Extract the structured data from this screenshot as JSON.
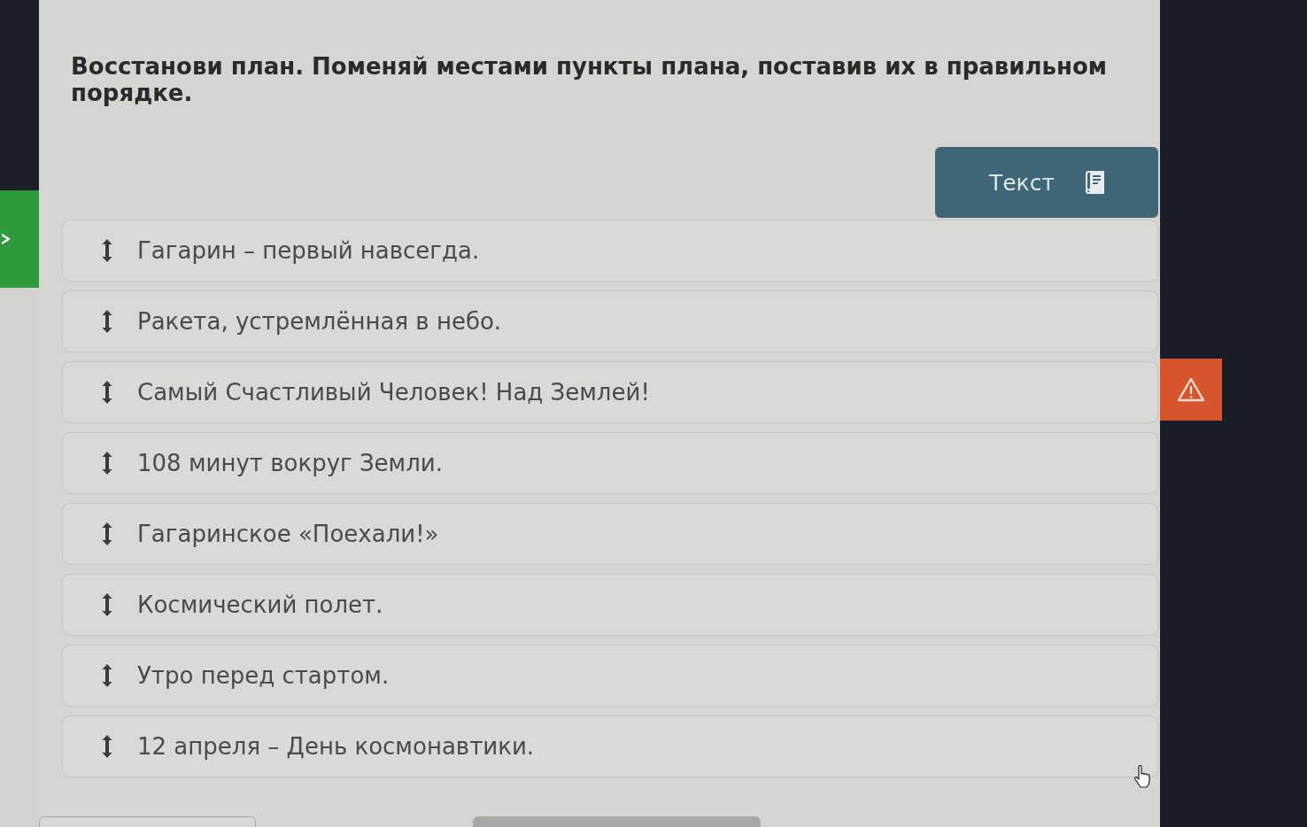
{
  "instruction": "Восстанови план. Поменяй местами пункты плана, поставив их в правильном порядке.",
  "text_button": {
    "label": "Текст"
  },
  "plan_items": [
    {
      "text": "Гагарин – первый навсегда."
    },
    {
      "text": "Ракета, устремлённая в небо."
    },
    {
      "text": "Самый Счастливый Человек! Над Землей!"
    },
    {
      "text": "108 минут вокруг Земли."
    },
    {
      "text": "Гагаринское «Поехали!»"
    },
    {
      "text": "Космический полет."
    },
    {
      "text": "Утро перед стартом."
    },
    {
      "text": "12 апреля – День космонавтики."
    }
  ]
}
